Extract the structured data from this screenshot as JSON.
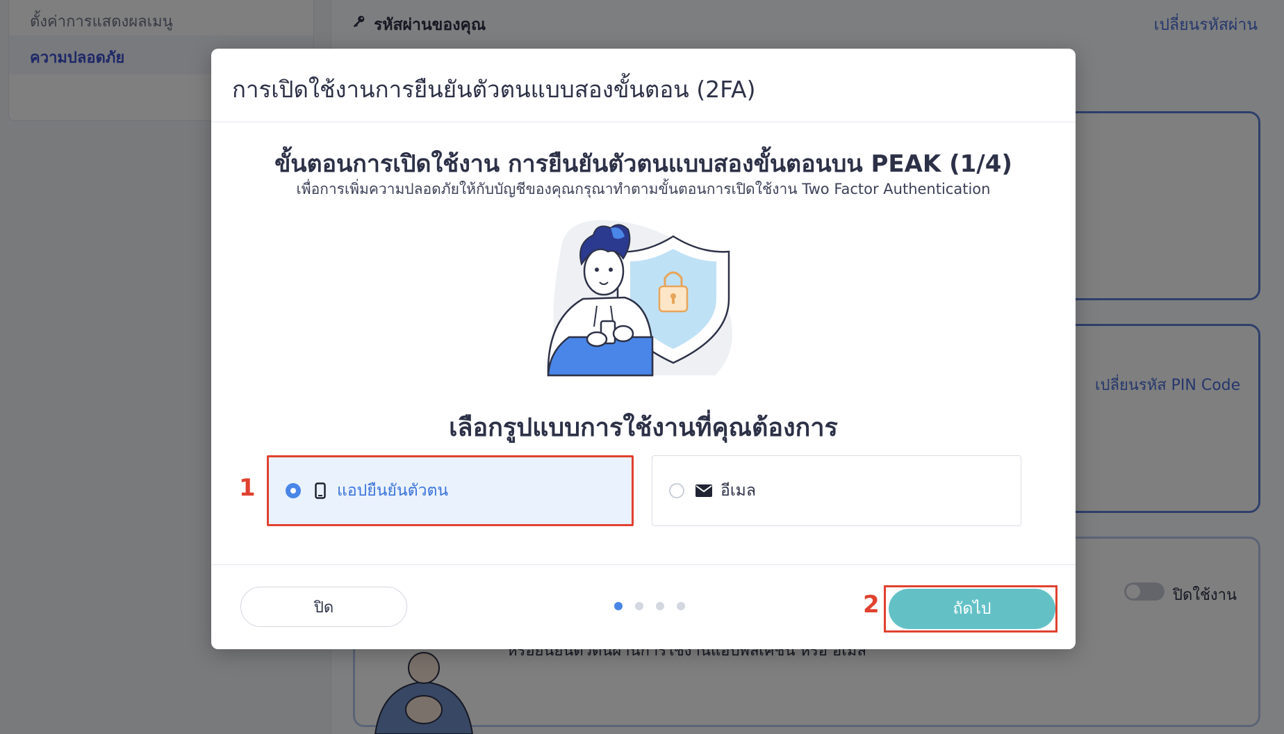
{
  "background": {
    "sidebar": {
      "items": [
        {
          "label": "ตั้งค่าการแสดงผลเมนู"
        },
        {
          "label": "ความปลอดภัย"
        }
      ]
    },
    "password_row": {
      "label": "รหัสผ่านของคุณ",
      "action": "เปลี่ยนรหัสผ่าน"
    },
    "pin_action": "เปลี่ยนรหัส PIN Code",
    "toggle_label": "ปิดใช้งาน",
    "partial_text": "หรือยืนยันตัวตนผ่านการใช้งานแอปพลิเคชัน หรือ อีเมล"
  },
  "modal": {
    "title": "การเปิดใช้งานการยืนยันตัวตนแบบสองขั้นตอน (2FA)",
    "step_title": "ขั้นตอนการเปิดใช้งาน การยืนยันตัวตนแบบสองขั้นตอนบน PEAK (1/4)",
    "step_subtitle": "เพื่อการเพิ่มความปลอดภัยให้กับบัญชีของคุณกรุณาทำตามขั้นตอนการเปิดใช้งาน Two Factor Authentication",
    "choose_title": "เลือกรูปแบบการใช้งานที่คุณต้องการ",
    "options": [
      {
        "label": "แอปยืนยันตัวตน",
        "icon": "smartphone-icon",
        "selected": true
      },
      {
        "label": "อีเมล",
        "icon": "envelope-icon",
        "selected": false
      }
    ],
    "close_label": "ปิด",
    "next_label": "ถัดไป",
    "steps_total": 4,
    "current_step": 1,
    "annotations": [
      "1",
      "2"
    ]
  },
  "colors": {
    "accent_blue": "#4a86e8",
    "next_button": "#63c1c6",
    "annotation_red": "#e0412f"
  }
}
